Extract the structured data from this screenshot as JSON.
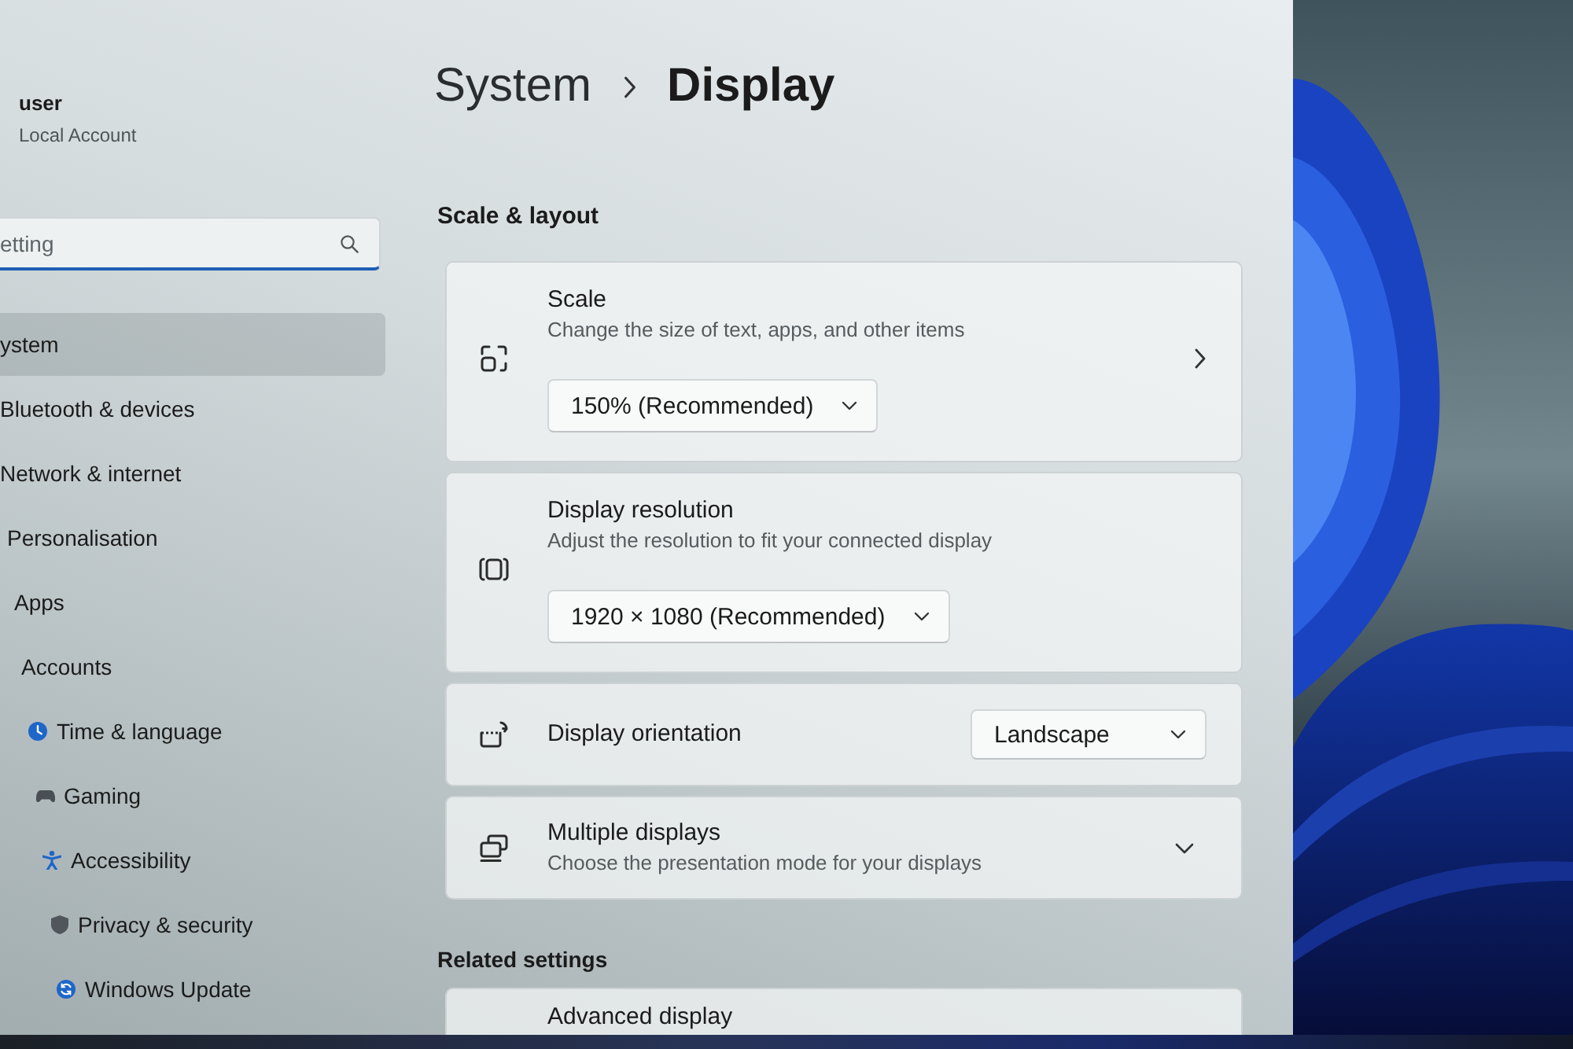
{
  "account": {
    "name": "user",
    "type": "Local Account"
  },
  "search": {
    "placeholder": "etting"
  },
  "nav": [
    {
      "label": "ystem",
      "selected": true
    },
    {
      "label": "Bluetooth & devices",
      "selected": false
    },
    {
      "label": "Network & internet",
      "selected": false
    },
    {
      "label": "Personalisation",
      "selected": false
    },
    {
      "label": "Apps",
      "selected": false
    },
    {
      "label": "Accounts",
      "selected": false
    },
    {
      "label": "Time & language",
      "selected": false
    },
    {
      "label": "Gaming",
      "selected": false
    },
    {
      "label": "Accessibility",
      "selected": false
    },
    {
      "label": "Privacy & security",
      "selected": false
    },
    {
      "label": "Windows Update",
      "selected": false
    }
  ],
  "breadcrumb": {
    "parent": "System",
    "current": "Display"
  },
  "section": {
    "title": "Scale & layout"
  },
  "settings": [
    {
      "kind": "stacked",
      "title": "Scale",
      "description": "Change the size of text, apps, and other items",
      "value": "150% (Recommended)",
      "navigates": true
    },
    {
      "kind": "stacked",
      "title": "Display resolution",
      "description": "Adjust the resolution to fit your connected display",
      "value": "1920 × 1080 (Recommended)",
      "navigates": false
    },
    {
      "kind": "inline",
      "title": "Display orientation",
      "value": "Landscape"
    },
    {
      "kind": "expander",
      "title": "Multiple displays",
      "description": "Choose the presentation mode for your displays",
      "expanded": false
    }
  ],
  "related": {
    "title": "Related settings",
    "items": [
      {
        "title": "Advanced display"
      }
    ]
  }
}
